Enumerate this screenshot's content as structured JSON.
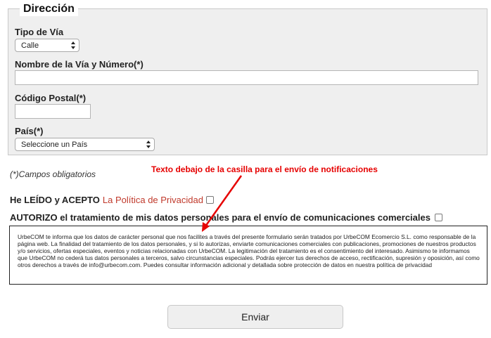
{
  "address": {
    "legend": "Dirección",
    "street_type": {
      "label": "Tipo de Vía",
      "selected": "Calle"
    },
    "street_name": {
      "label": "Nombre de la Vía y Número(*)",
      "value": ""
    },
    "postal_code": {
      "label": "Código Postal(*)",
      "value": ""
    },
    "country": {
      "label": "País(*)",
      "selected": "Seleccione un País"
    }
  },
  "required_note": "(*)Campos obligatorios",
  "annotation": {
    "text": "Texto debajo de la casilla para el envío de notificaciones",
    "color": "#e60000"
  },
  "consent": {
    "read_accept": {
      "prefix": "He LEÍDO y ACEPTO",
      "link": "La Política de Privacidad",
      "checked": false
    },
    "authorize": {
      "text": "AUTORIZO el tratamiento de mis datos personales para el envío de comunicaciones comerciales",
      "checked": false
    }
  },
  "privacy_text": "UrbeCOM te informa que los datos de carácter personal que nos facilites a través del presente formulario serán tratados por UrbeCOM Ecomercio S.L. como responsable de la página web. La finalidad del tratamiento de los datos personales, y si lo autorizas, enviarte comunicaciones comerciales con publicaciones, promociones de nuestros productos y/o servicios, ofertas especiales, eventos y noticias relacionadas con UrbeCOM. La legitimación del tratamiento es el consentimiento del interesado. Asimismo te informamos que UrbeCOM no cederá tus datos personales a terceros, salvo circunstancias especiales. Podrás ejercer tus derechos de acceso, rectificación, supresión y oposición, así como otros derechos a través de info@urbecom.com. Puedes consultar información adicional y detallada sobre protección de datos en nuestra política de privacidad",
  "submit": {
    "label": "Enviar"
  },
  "colors": {
    "panel_bg": "#efefef",
    "link": "#c0392b",
    "annotation": "#e60000"
  }
}
